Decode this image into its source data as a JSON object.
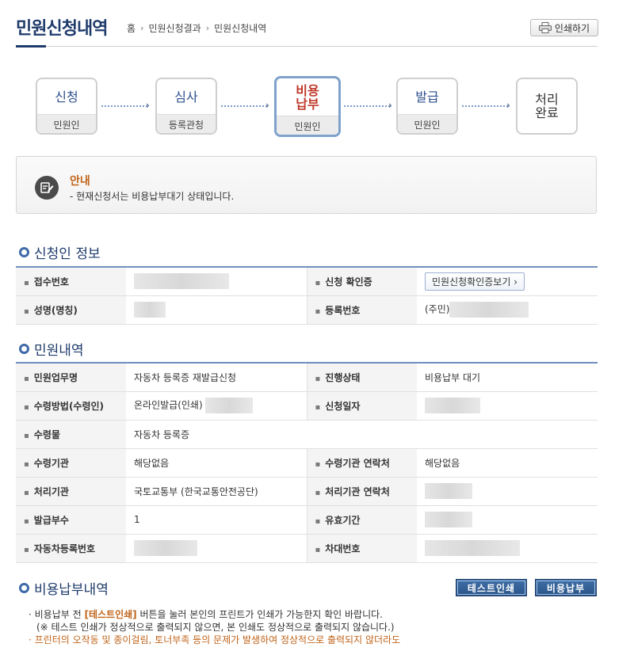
{
  "header": {
    "page_title": "민원신청내역",
    "breadcrumb": [
      "홈",
      "민원신청결과",
      "민원신청내역"
    ],
    "print_label": "인쇄하기"
  },
  "steps": [
    {
      "label": "신청",
      "sub": "민원인"
    },
    {
      "label": "심사",
      "sub": "등록관청"
    },
    {
      "label": "비용\n납부",
      "sub": "민원인"
    },
    {
      "label": "발급",
      "sub": "민원인"
    },
    {
      "label": "처리\n완료",
      "sub": ""
    }
  ],
  "notice": {
    "title": "안내",
    "text": "- 현재신청서는 비용납부대기 상태입니다."
  },
  "applicant": {
    "section_title": "신청인 정보",
    "receipt_no_label": "접수번호",
    "confirm_label": "신청 확인증",
    "confirm_button": "민원신청확인증보기",
    "name_label": "성명(명칭)",
    "reg_no_label": "등록번호",
    "reg_no_prefix": "(주민)"
  },
  "civil": {
    "section_title": "민원내역",
    "rows": [
      {
        "l1": "민원업무명",
        "v1": "자동차 등록증 재발급신청",
        "l2": "진행상태",
        "v2": "비용납부 대기"
      },
      {
        "l1": "수령방법(수령인)",
        "v1": "온라인발급(인쇄)",
        "l2": "신청일자",
        "v2": ""
      },
      {
        "l1": "수령물",
        "v1": "자동차 등록증"
      },
      {
        "l1": "수령기관",
        "v1": "해당없음",
        "l2": "수령기관 연락처",
        "v2": "해당없음"
      },
      {
        "l1": "처리기관",
        "v1": "국토교통부 (한국교통안전공단)",
        "l2": "처리기관 연락처",
        "v2": ""
      },
      {
        "l1": "발급부수",
        "v1": "1",
        "l2": "유효기간",
        "v2": ""
      },
      {
        "l1": "자동차등록번호",
        "v1": "",
        "l2": "차대번호",
        "v2": ""
      }
    ]
  },
  "fee": {
    "section_title": "비용납부내역",
    "test_print_button": "테스트인쇄",
    "pay_button": "비용납부",
    "note1_a": "· 비용납부 전 ",
    "note1_b": "[테스트인쇄]",
    "note1_c": " 버튼을 눌러 본인의 프린트가 인쇄가 가능한지 확인 바랍니다.",
    "note2": "(※ 테스트 인쇄가 정상적으로 출력되지 않으면, 본 인쇄도 정상적으로 출력되지 않습니다.)",
    "note3": "· 프린터의 오작동 및 종이걸림, 토너부족 등의 문제가 발생하여 정상적으로 출력되지 않더라도"
  }
}
